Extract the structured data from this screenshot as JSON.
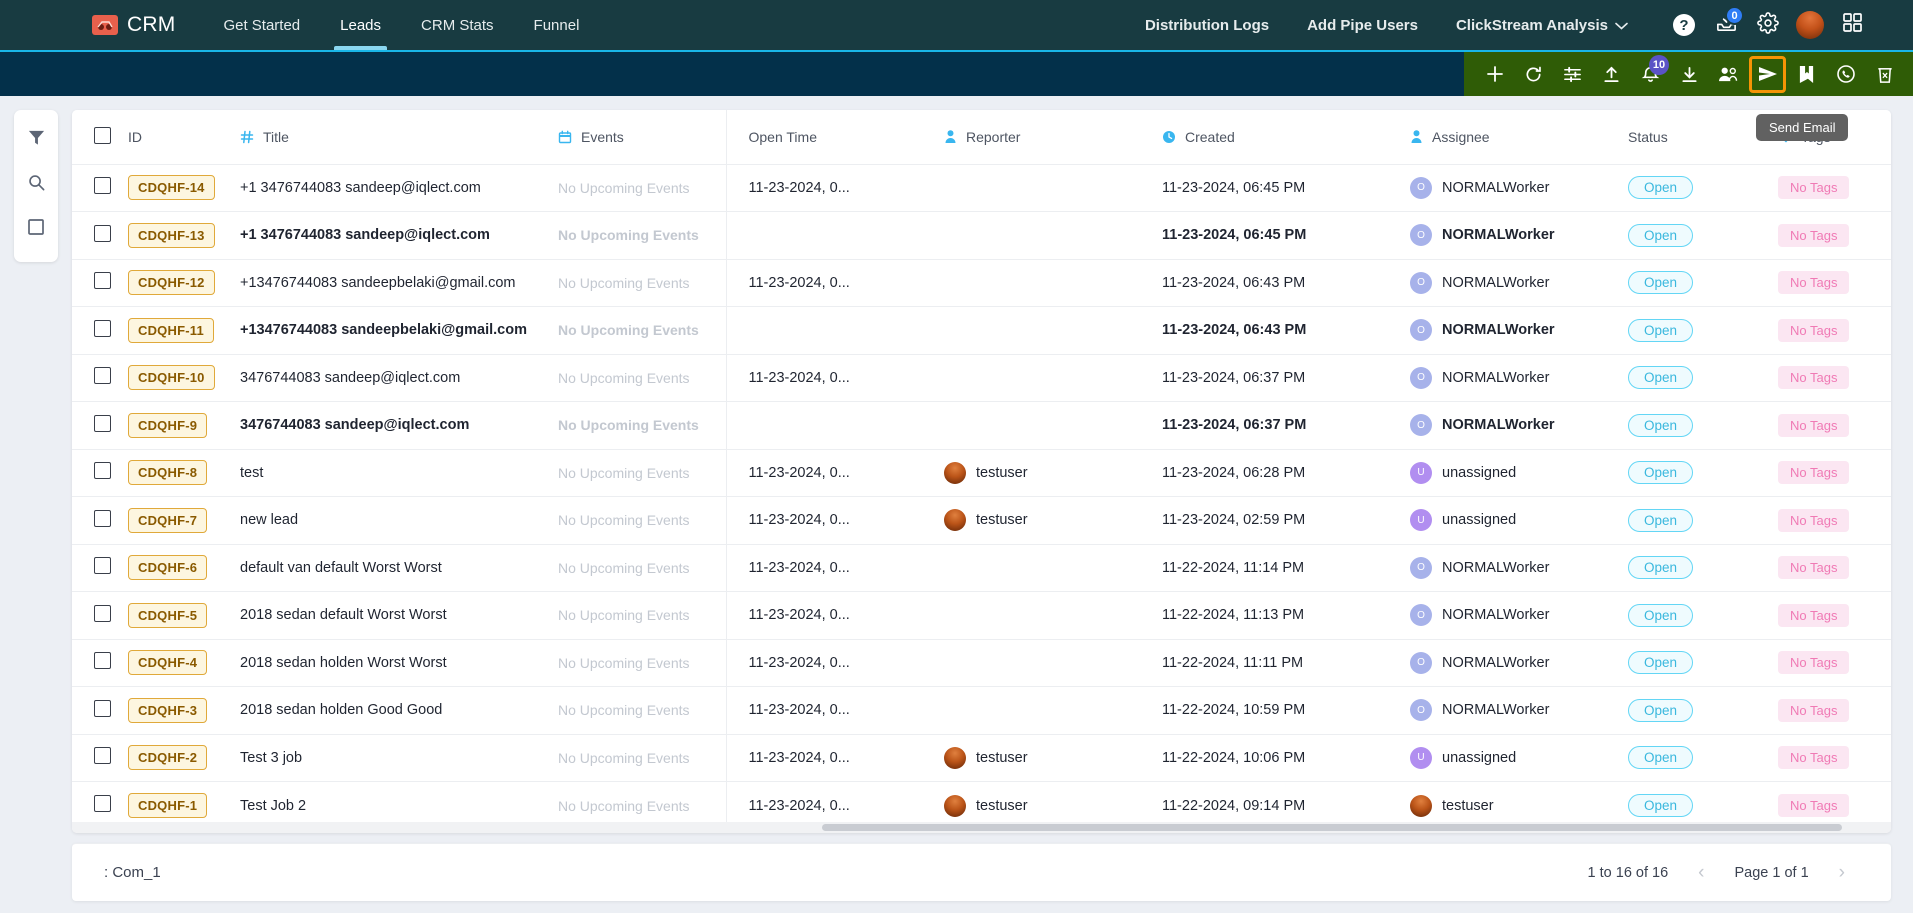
{
  "topnav": {
    "brand": "CRM",
    "links": [
      {
        "label": "Get Started",
        "active": false
      },
      {
        "label": "Leads",
        "active": true
      },
      {
        "label": "CRM Stats",
        "active": false
      },
      {
        "label": "Funnel",
        "active": false
      }
    ],
    "right_links": [
      {
        "label": "Distribution Logs"
      },
      {
        "label": "Add Pipe Users"
      },
      {
        "label": "ClickStream Analysis"
      }
    ],
    "help_label": "?",
    "inbox_badge": "0",
    "icons": [
      "help-icon",
      "inbox-download-icon",
      "gear-icon",
      "avatar",
      "apps-grid-icon"
    ]
  },
  "actionbar": {
    "icons": [
      {
        "name": "add-icon",
        "label": "Add"
      },
      {
        "name": "refresh-icon",
        "label": "Refresh"
      },
      {
        "name": "filter-settings-icon",
        "label": "Filter Settings"
      },
      {
        "name": "upload-icon",
        "label": "Upload"
      },
      {
        "name": "bell-icon",
        "label": "Notifications",
        "badge": "10"
      },
      {
        "name": "download-icon",
        "label": "Download"
      },
      {
        "name": "add-users-icon",
        "label": "Add Users"
      },
      {
        "name": "send-email-icon",
        "label": "Send Email",
        "highlight": true
      },
      {
        "name": "note-icon",
        "label": "Note"
      },
      {
        "name": "whatsapp-icon",
        "label": "WhatsApp"
      },
      {
        "name": "delete-icon",
        "label": "Delete"
      }
    ],
    "tooltip": "Send Email"
  },
  "leftrail": {
    "items": [
      {
        "name": "filter-icon",
        "label": "Filter"
      },
      {
        "name": "search-icon",
        "label": "Search"
      },
      {
        "name": "select-box-icon",
        "label": "Select"
      }
    ]
  },
  "table": {
    "columns": [
      {
        "key": "check",
        "label": "",
        "icon": "checkbox-icon"
      },
      {
        "key": "id",
        "label": "ID",
        "icon": ""
      },
      {
        "key": "title",
        "label": "Title",
        "icon": "hash-icon"
      },
      {
        "key": "events",
        "label": "Events",
        "icon": "calendar-icon"
      },
      {
        "key": "open_time",
        "label": "Open Time",
        "icon": ""
      },
      {
        "key": "reporter",
        "label": "Reporter",
        "icon": "person-icon"
      },
      {
        "key": "created",
        "label": "Created",
        "icon": "clock-icon"
      },
      {
        "key": "assignee",
        "label": "Assignee",
        "icon": "person-icon"
      },
      {
        "key": "status",
        "label": "Status",
        "icon": ""
      },
      {
        "key": "tags",
        "label": "Tags",
        "icon": "tag-icon"
      }
    ],
    "rows": [
      {
        "id": "CDQHF-14",
        "title": "+1 3476744083 sandeep@iqlect.com",
        "events": "No Upcoming Events",
        "open_time": "11-23-2024, 0...",
        "reporter": "",
        "reporter_avatar": "",
        "created": "11-23-2024, 06:45 PM",
        "assignee": "NORMALWorker",
        "assignee_initial": "O",
        "assignee_avatar": "blue",
        "status": "Open",
        "tags": "No Tags",
        "bold": false
      },
      {
        "id": "CDQHF-13",
        "title": "+1 3476744083 sandeep@iqlect.com",
        "events": "No Upcoming Events",
        "open_time": "",
        "reporter": "",
        "reporter_avatar": "",
        "created": "11-23-2024, 06:45 PM",
        "assignee": "NORMALWorker",
        "assignee_initial": "O",
        "assignee_avatar": "blue",
        "status": "Open",
        "tags": "No Tags",
        "bold": true
      },
      {
        "id": "CDQHF-12",
        "title": "+13476744083 sandeepbelaki@gmail.com",
        "events": "No Upcoming Events",
        "open_time": "11-23-2024, 0...",
        "reporter": "",
        "reporter_avatar": "",
        "created": "11-23-2024, 06:43 PM",
        "assignee": "NORMALWorker",
        "assignee_initial": "O",
        "assignee_avatar": "blue",
        "status": "Open",
        "tags": "No Tags",
        "bold": false
      },
      {
        "id": "CDQHF-11",
        "title": "+13476744083 sandeepbelaki@gmail.com",
        "events": "No Upcoming Events",
        "open_time": "",
        "reporter": "",
        "reporter_avatar": "",
        "created": "11-23-2024, 06:43 PM",
        "assignee": "NORMALWorker",
        "assignee_initial": "O",
        "assignee_avatar": "blue",
        "status": "Open",
        "tags": "No Tags",
        "bold": true
      },
      {
        "id": "CDQHF-10",
        "title": "3476744083 sandeep@iqlect.com",
        "events": "No Upcoming Events",
        "open_time": "11-23-2024, 0...",
        "reporter": "",
        "reporter_avatar": "",
        "created": "11-23-2024, 06:37 PM",
        "assignee": "NORMALWorker",
        "assignee_initial": "O",
        "assignee_avatar": "blue",
        "status": "Open",
        "tags": "No Tags",
        "bold": false
      },
      {
        "id": "CDQHF-9",
        "title": "3476744083 sandeep@iqlect.com",
        "events": "No Upcoming Events",
        "open_time": "",
        "reporter": "",
        "reporter_avatar": "",
        "created": "11-23-2024, 06:37 PM",
        "assignee": "NORMALWorker",
        "assignee_initial": "O",
        "assignee_avatar": "blue",
        "status": "Open",
        "tags": "No Tags",
        "bold": true
      },
      {
        "id": "CDQHF-8",
        "title": "test",
        "events": "No Upcoming Events",
        "open_time": "11-23-2024, 0...",
        "reporter": "testuser",
        "reporter_avatar": "photo",
        "created": "11-23-2024, 06:28 PM",
        "assignee": "unassigned",
        "assignee_initial": "U",
        "assignee_avatar": "purple",
        "status": "Open",
        "tags": "No Tags",
        "bold": false
      },
      {
        "id": "CDQHF-7",
        "title": "new lead",
        "events": "No Upcoming Events",
        "open_time": "11-23-2024, 0...",
        "reporter": "testuser",
        "reporter_avatar": "photo",
        "created": "11-23-2024, 02:59 PM",
        "assignee": "unassigned",
        "assignee_initial": "U",
        "assignee_avatar": "purple",
        "status": "Open",
        "tags": "No Tags",
        "bold": false
      },
      {
        "id": "CDQHF-6",
        "title": "default van default Worst Worst",
        "events": "No Upcoming Events",
        "open_time": "11-23-2024, 0...",
        "reporter": "",
        "reporter_avatar": "",
        "created": "11-22-2024, 11:14 PM",
        "assignee": "NORMALWorker",
        "assignee_initial": "O",
        "assignee_avatar": "blue",
        "status": "Open",
        "tags": "No Tags",
        "bold": false
      },
      {
        "id": "CDQHF-5",
        "title": "2018 sedan default Worst Worst",
        "events": "No Upcoming Events",
        "open_time": "11-23-2024, 0...",
        "reporter": "",
        "reporter_avatar": "",
        "created": "11-22-2024, 11:13 PM",
        "assignee": "NORMALWorker",
        "assignee_initial": "O",
        "assignee_avatar": "blue",
        "status": "Open",
        "tags": "No Tags",
        "bold": false
      },
      {
        "id": "CDQHF-4",
        "title": "2018 sedan holden Worst Worst",
        "events": "No Upcoming Events",
        "open_time": "11-23-2024, 0...",
        "reporter": "",
        "reporter_avatar": "",
        "created": "11-22-2024, 11:11 PM",
        "assignee": "NORMALWorker",
        "assignee_initial": "O",
        "assignee_avatar": "blue",
        "status": "Open",
        "tags": "No Tags",
        "bold": false
      },
      {
        "id": "CDQHF-3",
        "title": "2018 sedan holden Good Good",
        "events": "No Upcoming Events",
        "open_time": "11-23-2024, 0...",
        "reporter": "",
        "reporter_avatar": "",
        "created": "11-22-2024, 10:59 PM",
        "assignee": "NORMALWorker",
        "assignee_initial": "O",
        "assignee_avatar": "blue",
        "status": "Open",
        "tags": "No Tags",
        "bold": false
      },
      {
        "id": "CDQHF-2",
        "title": "Test 3 job",
        "events": "No Upcoming Events",
        "open_time": "11-23-2024, 0...",
        "reporter": "testuser",
        "reporter_avatar": "photo",
        "created": "11-22-2024, 10:06 PM",
        "assignee": "unassigned",
        "assignee_initial": "U",
        "assignee_avatar": "purple",
        "status": "Open",
        "tags": "No Tags",
        "bold": false
      },
      {
        "id": "CDQHF-1",
        "title": "Test Job 2",
        "events": "No Upcoming Events",
        "open_time": "11-23-2024, 0...",
        "reporter": "testuser",
        "reporter_avatar": "photo",
        "created": "11-22-2024, 09:14 PM",
        "assignee": "testuser",
        "assignee_initial": "",
        "assignee_avatar": "photo",
        "status": "Open",
        "tags": "No Tags",
        "bold": false
      }
    ]
  },
  "footer": {
    "left_label": ": Com_1",
    "range": "1 to 16 of 16",
    "page": "Page 1 of 1",
    "prev": "‹",
    "next": "›"
  },
  "colors": {
    "nav_bg": "#183b41",
    "actionbar_bg": "#03304a",
    "actionbar_green": "#2f5c06",
    "accent_cyan": "#19b6e8",
    "highlight_orange": "#f59405",
    "id_chip": "#e0a93a",
    "tag_pink": "#f07ab5"
  }
}
